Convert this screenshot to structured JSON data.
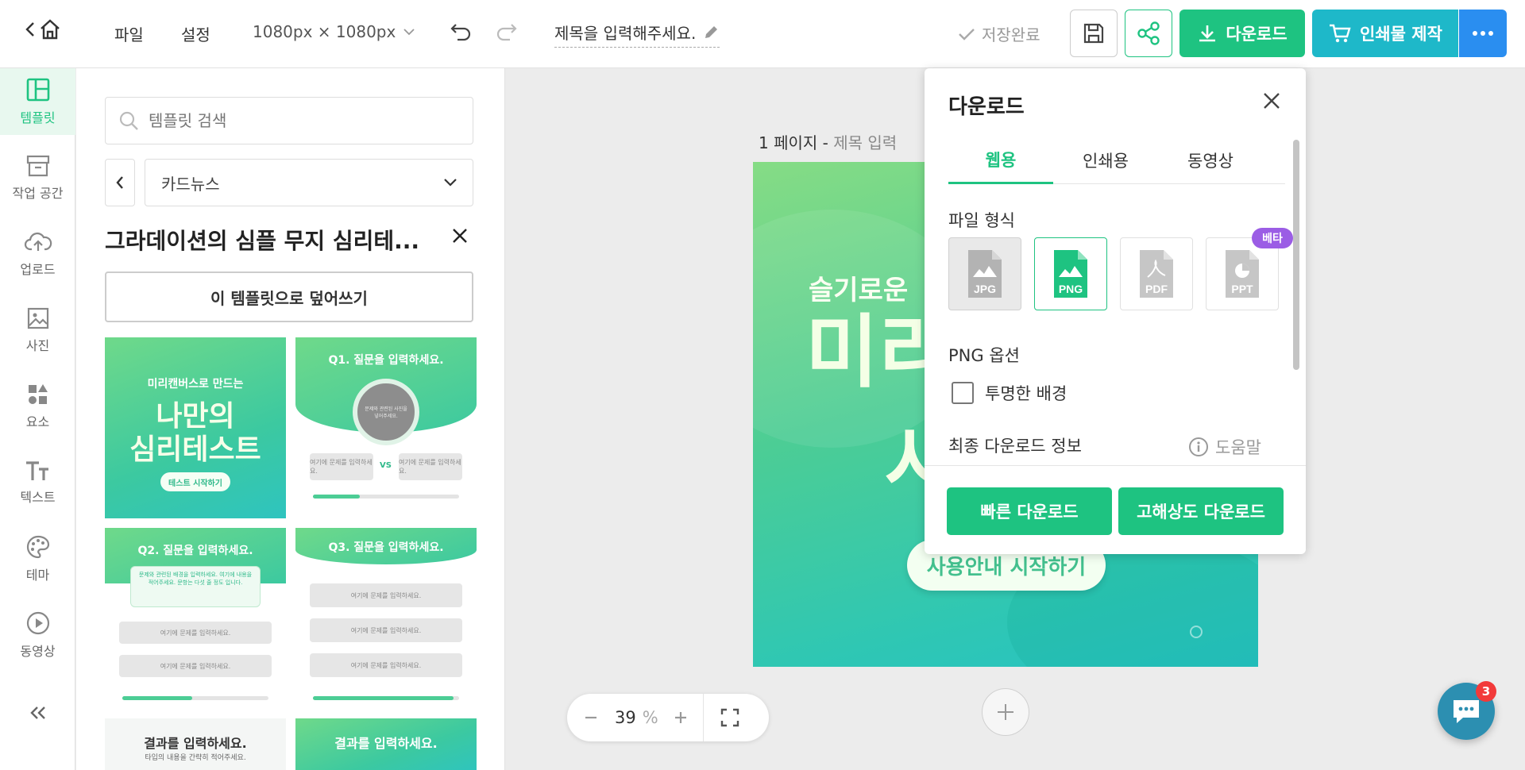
{
  "header": {
    "menu_file": "파일",
    "menu_settings": "설정",
    "size_label": "1080px × 1080px",
    "doc_title": "제목을 입력해주세요.",
    "save_status": "저장완료",
    "download_label": "다운로드",
    "print_label": "인쇄물 제작"
  },
  "sidebar": {
    "items": [
      {
        "label": "템플릿",
        "icon": "layout-icon"
      },
      {
        "label": "작업 공간",
        "icon": "archive-icon"
      },
      {
        "label": "업로드",
        "icon": "cloud-upload-icon"
      },
      {
        "label": "사진",
        "icon": "image-icon"
      },
      {
        "label": "요소",
        "icon": "shapes-icon"
      },
      {
        "label": "텍스트",
        "icon": "text-icon"
      },
      {
        "label": "테마",
        "icon": "palette-icon"
      },
      {
        "label": "동영상",
        "icon": "play-icon"
      }
    ],
    "active": "템플릿",
    "accent": "#1ec381"
  },
  "template_panel": {
    "search_placeholder": "템플릿 검색",
    "category": "카드뉴스",
    "template_title": "그라데이션의 심플 무지 심리테...",
    "overwrite_button": "이 템플릿으로 덮어쓰기",
    "thumbs": {
      "t1_small": "미리캔버스로 만드는",
      "t1_big1": "나만의",
      "t1_big2": "심리테스트",
      "t1_btn": "테스트 시작하기",
      "t2_title": "Q1. 질문을 입력하세요.",
      "t2_circle": "문제와 관련된 사진을 넣어주세요.",
      "t2_opt": "여기에 문제를 입력하세요.",
      "t2_vs": "VS",
      "t3_title": "Q2. 질문을 입력하세요.",
      "t3_box": "문제와 관련된 배경을 입력하세요. 여기에 내용을 적어주세요. 문항는 다섯 줄 정도 입니다.",
      "t3_opt": "여기에 문제를 입력하세요.",
      "t4_title": "Q3. 질문을 입력하세요.",
      "t4_opt": "여기에 문제를 입력하세요.",
      "t5_title": "결과를 입력하세요.",
      "t5_sub": "타입의 내용을 간략히 적어주세요.",
      "t6_title": "결과를 입력하세요."
    }
  },
  "canvas": {
    "page_label": "1 페이지 -",
    "page_title_placeholder": "제목 입력",
    "small_title": "슬기로운",
    "big1": "미리",
    "big2": "사",
    "start_button": "사용안내 시작하기",
    "zoom_value": "39",
    "zoom_unit": "%"
  },
  "download_panel": {
    "title": "다운로드",
    "tabs": [
      "웹용",
      "인쇄용",
      "동영상"
    ],
    "active_tab": "웹용",
    "file_format_label": "파일 형식",
    "formats": [
      "JPG",
      "PNG",
      "PDF",
      "PPT"
    ],
    "selected_format": "PNG",
    "beta_badge": "베타",
    "options_label": "PNG 옵션",
    "transparent_bg_label": "투명한 배경",
    "transparent_bg_checked": false,
    "final_info_label": "최종 다운로드 정보",
    "help_label": "도움말",
    "quick_download": "빠른 다운로드",
    "hires_download": "고해상도 다운로드"
  },
  "chat": {
    "badge_count": "3"
  },
  "colors": {
    "green": "#1ec381",
    "teal": "#1eb8c9",
    "blue": "#2a8ef0",
    "purple": "#9b5de5"
  }
}
